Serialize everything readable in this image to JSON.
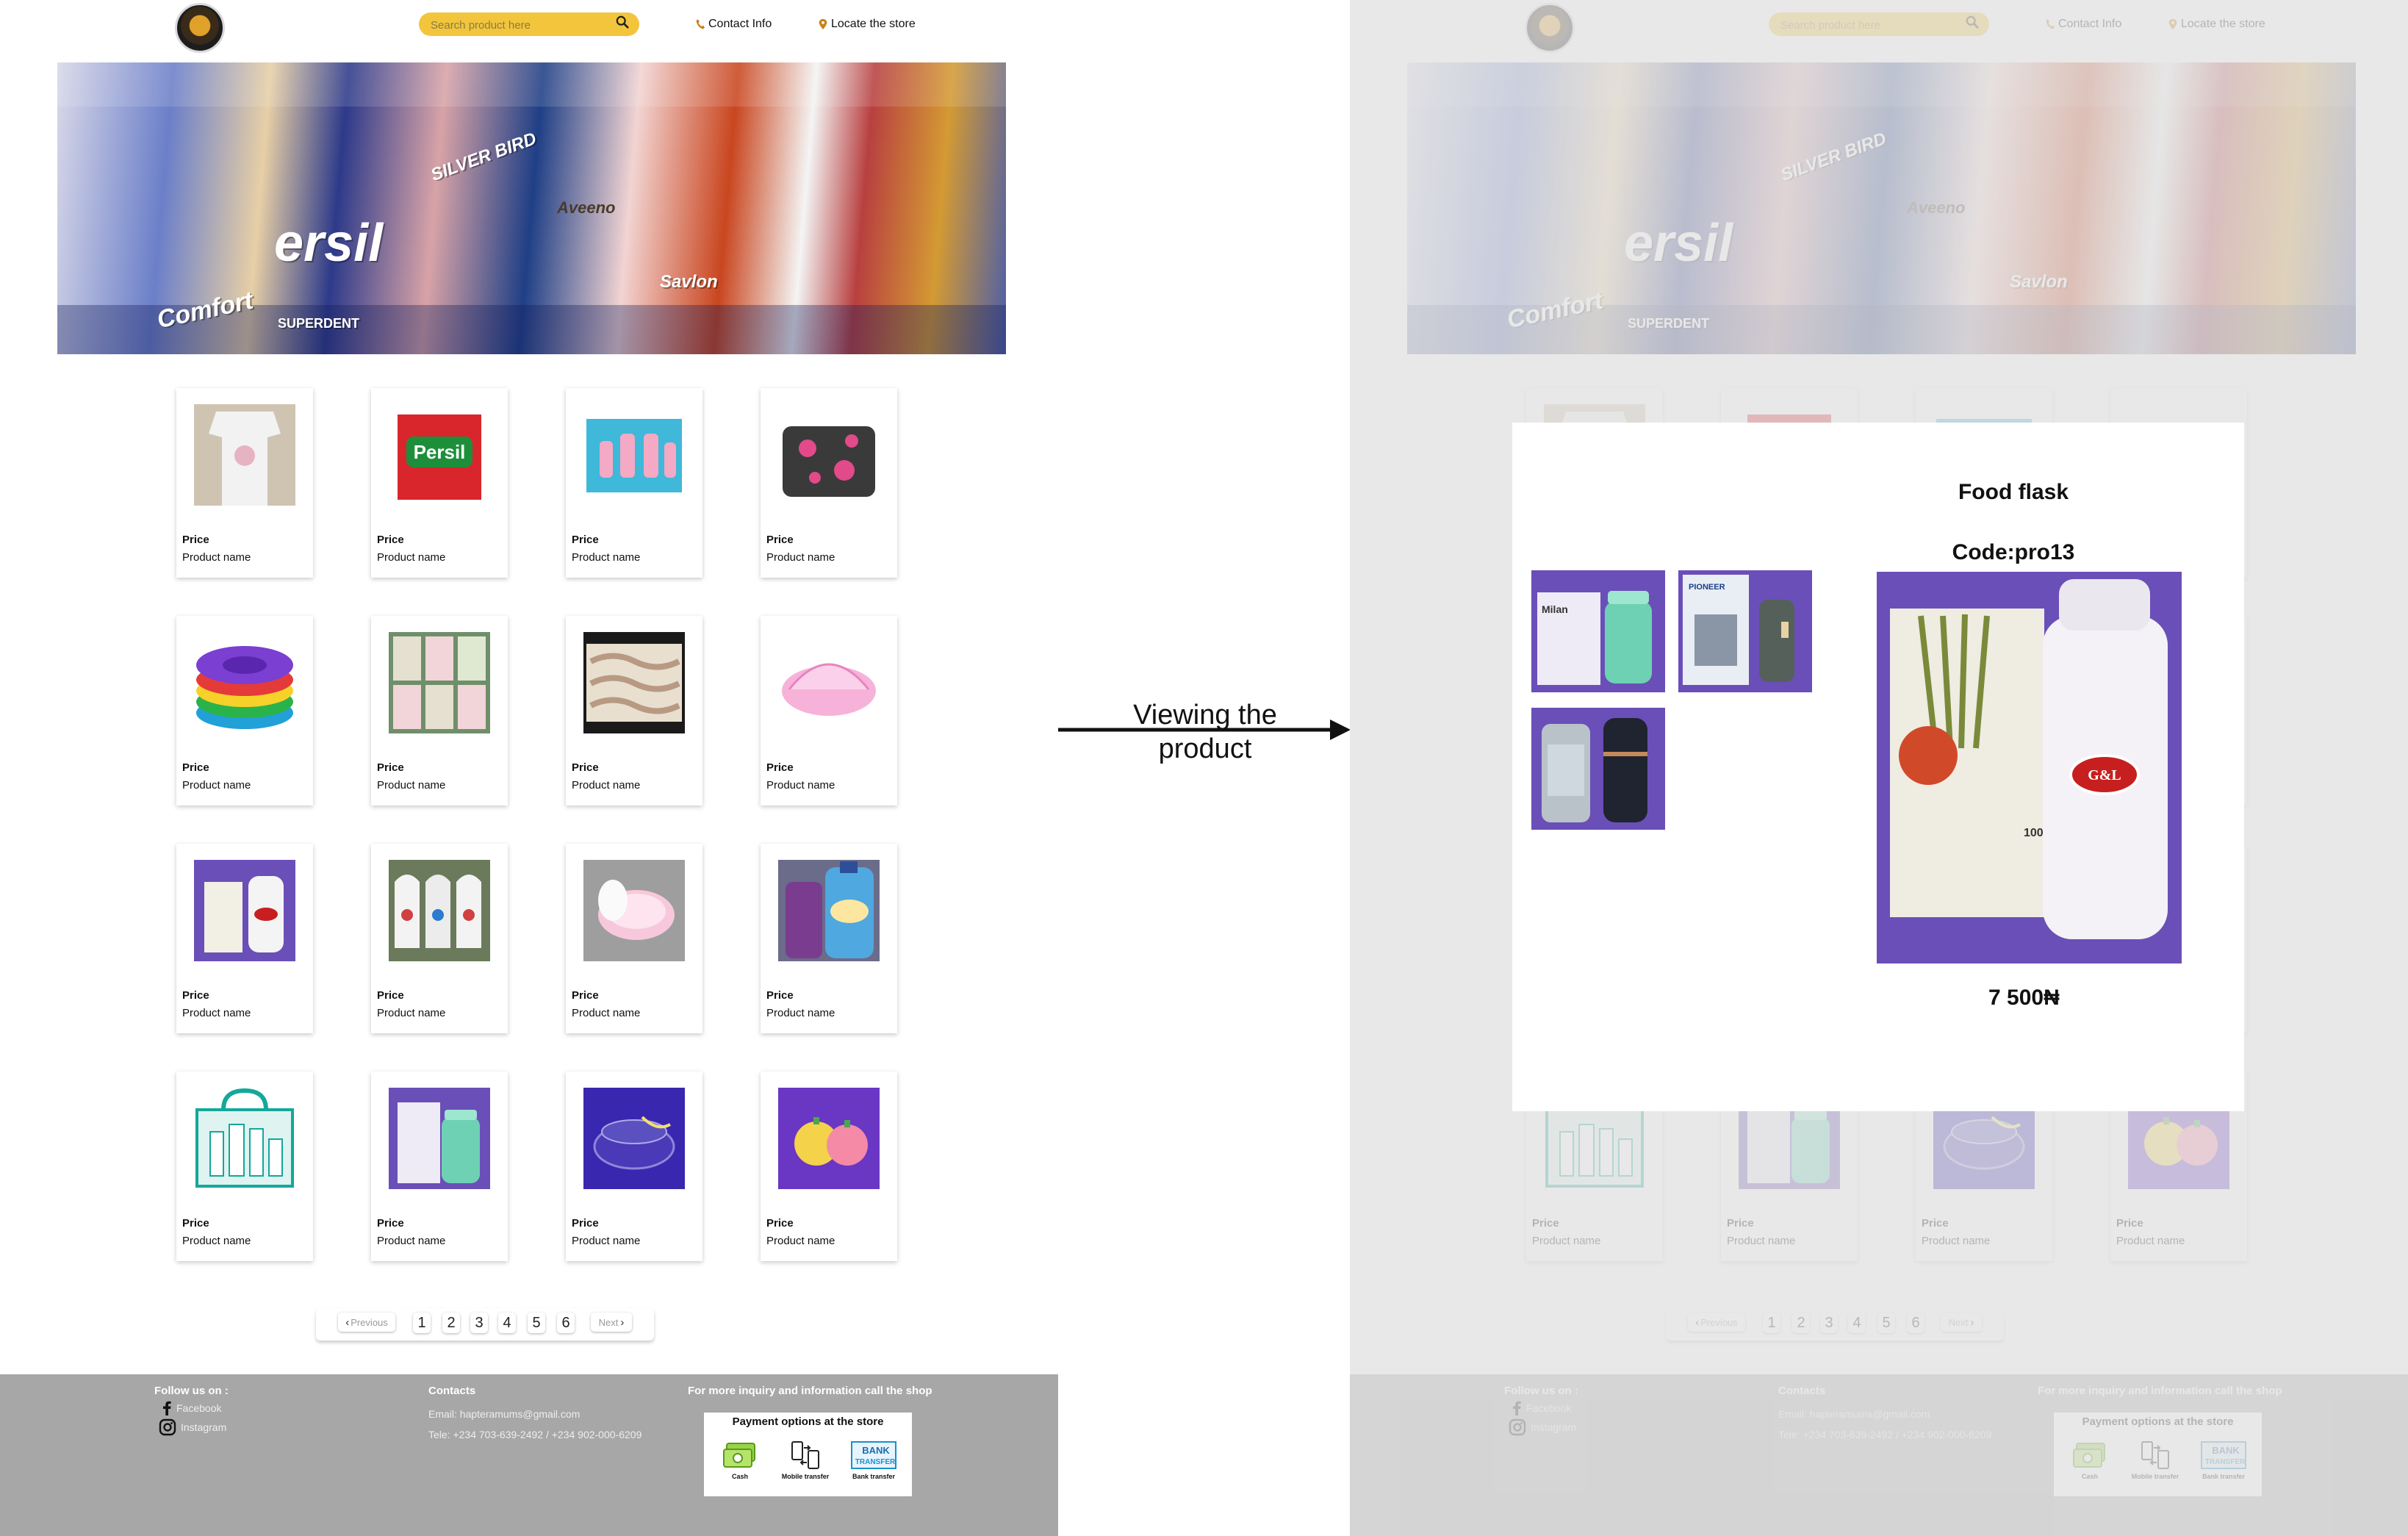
{
  "header": {
    "search_placeholder": "Search product here",
    "contact_label": "Contact Info",
    "locate_label": "Locate the store"
  },
  "hero": {
    "text_1": "ersil",
    "text_2": "Comfort",
    "text_3": "SUPERDENT",
    "text_4": "SILVER BIRD",
    "text_5": "Savlon",
    "text_6": "Aveeno"
  },
  "products": [
    {
      "price": "Price",
      "name": "Product name"
    },
    {
      "price": "Price",
      "name": "Product name"
    },
    {
      "price": "Price",
      "name": "Product name"
    },
    {
      "price": "Price",
      "name": "Product name"
    },
    {
      "price": "Price",
      "name": "Product name"
    },
    {
      "price": "Price",
      "name": "Product name"
    },
    {
      "price": "Price",
      "name": "Product name"
    },
    {
      "price": "Price",
      "name": "Product name"
    },
    {
      "price": "Price",
      "name": "Product name"
    },
    {
      "price": "Price",
      "name": "Product name"
    },
    {
      "price": "Price",
      "name": "Product name"
    },
    {
      "price": "Price",
      "name": "Product name"
    },
    {
      "price": "Price",
      "name": "Product name"
    },
    {
      "price": "Price",
      "name": "Product name"
    },
    {
      "price": "Price",
      "name": "Product name"
    },
    {
      "price": "Price",
      "name": "Product name"
    }
  ],
  "pagination": {
    "previous": "Previous",
    "pages": [
      "1",
      "2",
      "3",
      "4",
      "5",
      "6"
    ],
    "next": "Next"
  },
  "footer": {
    "follow_heading": "Follow us on :",
    "facebook": "Facebook",
    "instagram": "Instagram",
    "contacts_heading": "Contacts",
    "email": "Email: hapteramums@gmail.com",
    "tele": "Tele: +234 703-639-2492 / +234 902-000-6209",
    "inquiry": "For more inquiry and information call the shop",
    "payment_title": "Payment options at the store",
    "payment_cash": "Cash",
    "payment_mobile": "Mobile transfer",
    "payment_bank": "Bank transfer",
    "bank_logo_text_1": "BANK",
    "bank_logo_text_2": "TRANSFER"
  },
  "annotation": {
    "line1": "Viewing the",
    "line2": "product"
  },
  "modal": {
    "title": "Food flask",
    "code": "Code:pro13",
    "price": "7 500₦",
    "thumb_text_1": "Milan",
    "thumb_text_2": "PIONEER",
    "main_brand": "G&L",
    "main_volume": "1000ML"
  },
  "colors": {
    "search_bg": "#f2c53d",
    "footer_bg": "#a7a7a7",
    "modal_product_bg": "#6a4fb8"
  }
}
